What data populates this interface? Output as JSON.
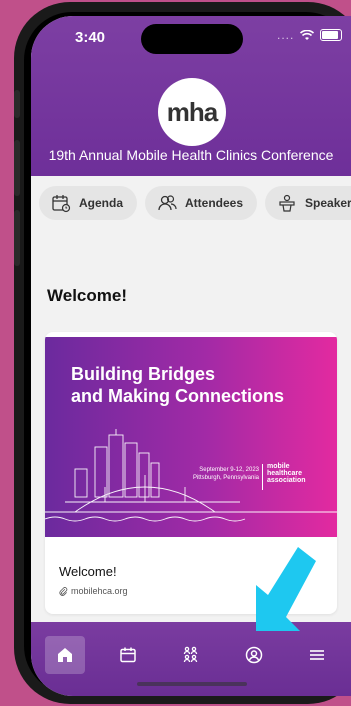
{
  "status_bar": {
    "time": "3:40",
    "signal": "....",
    "wifi_icon": "wifi-icon",
    "battery_icon": "battery-icon"
  },
  "header": {
    "logo_text": "mha",
    "conference_title": "19th Annual Mobile Health Clinics Conference"
  },
  "tabs": [
    {
      "label": "Agenda",
      "icon": "calendar-icon"
    },
    {
      "label": "Attendees",
      "icon": "users-icon"
    },
    {
      "label": "Speakers",
      "icon": "podium-icon"
    }
  ],
  "main": {
    "welcome_heading": "Welcome!",
    "card": {
      "banner_line1": "Building Bridges",
      "banner_line2": "and Making Connections",
      "banner_date_line1": "September 9-12, 2023",
      "banner_date_line2": "Pittsburgh, Pennsylvania",
      "banner_assoc_line1": "mobile",
      "banner_assoc_line2": "healthcare",
      "banner_assoc_line3": "association",
      "title": "Welcome!",
      "link": "mobilehca.org"
    }
  },
  "bottom_nav": [
    {
      "name": "home",
      "icon": "home-icon",
      "active": true
    },
    {
      "name": "calendar",
      "icon": "calendar-icon"
    },
    {
      "name": "people",
      "icon": "people-icon"
    },
    {
      "name": "profile",
      "icon": "profile-icon"
    },
    {
      "name": "menu",
      "icon": "menu-icon"
    }
  ],
  "colors": {
    "brand_purple": "#6e2f99",
    "accent_magenta": "#e32aa0",
    "arrow_blue": "#1ec8f0"
  }
}
